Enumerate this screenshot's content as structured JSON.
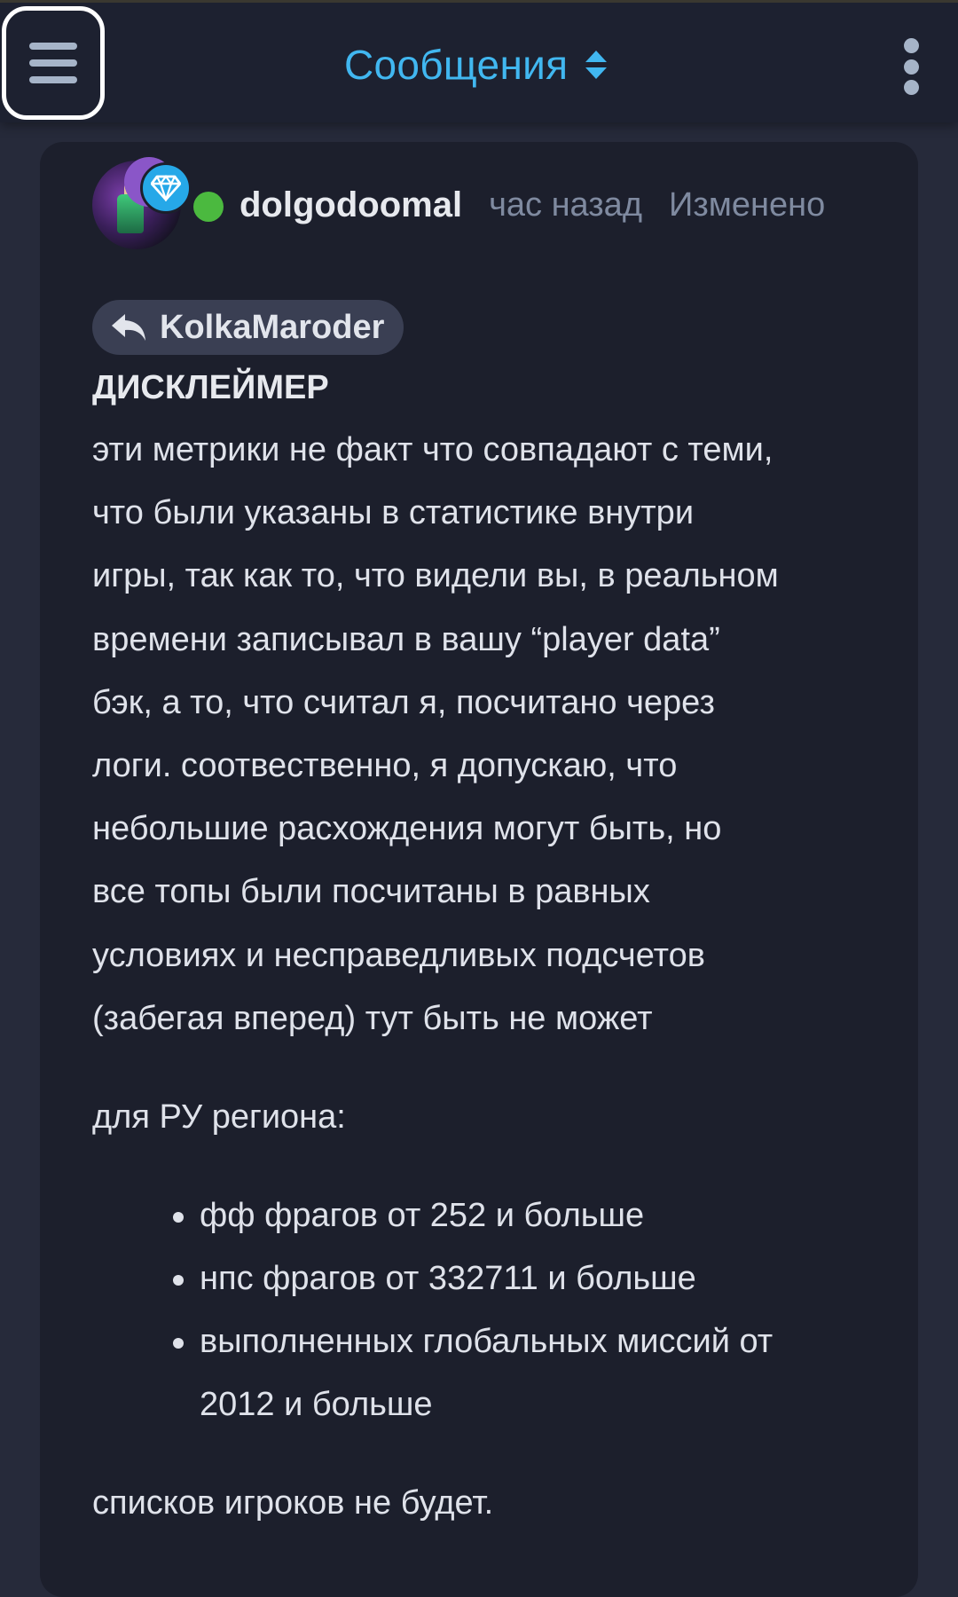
{
  "header": {
    "title": "Сообщения",
    "menu_icon": "hamburger-menu-icon",
    "sort_icon": "sort-updown-icon",
    "more_icon": "vertical-dots-icon"
  },
  "post": {
    "author": "dolgodoomal",
    "time": "час назад",
    "edited": "Изменено",
    "status": "online",
    "reply_to": "KolkaMaroder",
    "heading": "ДИСКЛЕЙМЕР",
    "paragraph_lines": [
      "эти метрики не факт что совпадают с теми,",
      "что были указаны в статистике внутри",
      "игры, так как то, что видели вы, в реальном",
      "времени записывал в вашу “player data”",
      "бэк, а то, что считал я, посчитано через",
      "логи. соотвественно, я допускаю, что",
      "небольшие расхождения могут быть, но",
      "все топы были посчитаны в равных",
      "условиях и несправедливых подсчетов",
      "(забегая вперед) тут быть не может"
    ],
    "region_label": "для РУ региона:",
    "list_items": [
      "фф фрагов от 252 и больше",
      "нпс фрагов от 332711 и больше",
      "выполненных глобальных миссий от",
      "2012 и больше"
    ],
    "closing": "списков игроков не будет."
  },
  "colors": {
    "accent": "#41b7f0",
    "background": "#262a3a",
    "card": "#1c1f2c",
    "online": "#4bb93f"
  }
}
